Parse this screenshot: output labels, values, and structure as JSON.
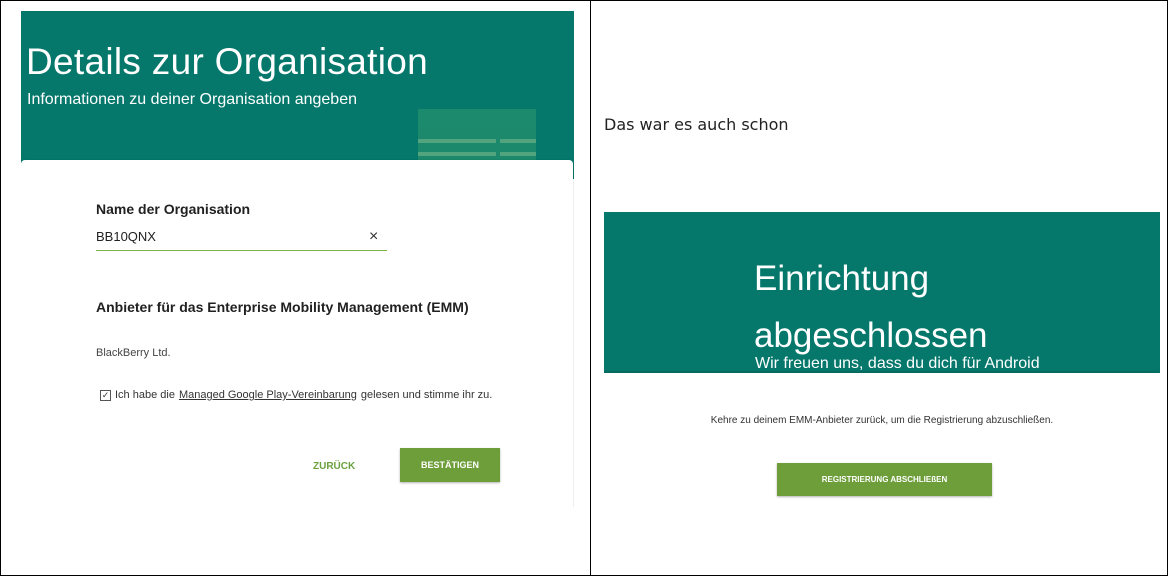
{
  "left": {
    "title": "Details zur Organisation",
    "subtitle": "Informationen zu deiner Organisation angeben",
    "org_name_label": "Name der Organisation",
    "org_name_value": "BB10QNX",
    "clear_symbol": "×",
    "emm_label": "Anbieter für das Enterprise Mobility Management (EMM)",
    "provider": "BlackBerry Ltd.",
    "checkbox_mark": "✓",
    "agree_prefix": "Ich habe die",
    "agree_link": "Managed Google Play-Vereinbarung",
    "agree_suffix": "gelesen und stimme ihr zu.",
    "back_label": "ZURÜCK",
    "confirm_label": "BESTÄTIGEN"
  },
  "right": {
    "note": "Das war es auch schon",
    "title_line1": "Einrichtung",
    "title_line2": "abgeschlossen",
    "subtitle": "Wir freuen uns, dass du dich für Android",
    "return_text": "Kehre zu deinem EMM-Anbieter zurück, um die Registrierung abzuschließen.",
    "finish_label": "REGISTRIERUNG ABSCHLIEßEN"
  },
  "colors": {
    "header_teal": "#05776b",
    "accent_green": "#6d9e3a"
  }
}
